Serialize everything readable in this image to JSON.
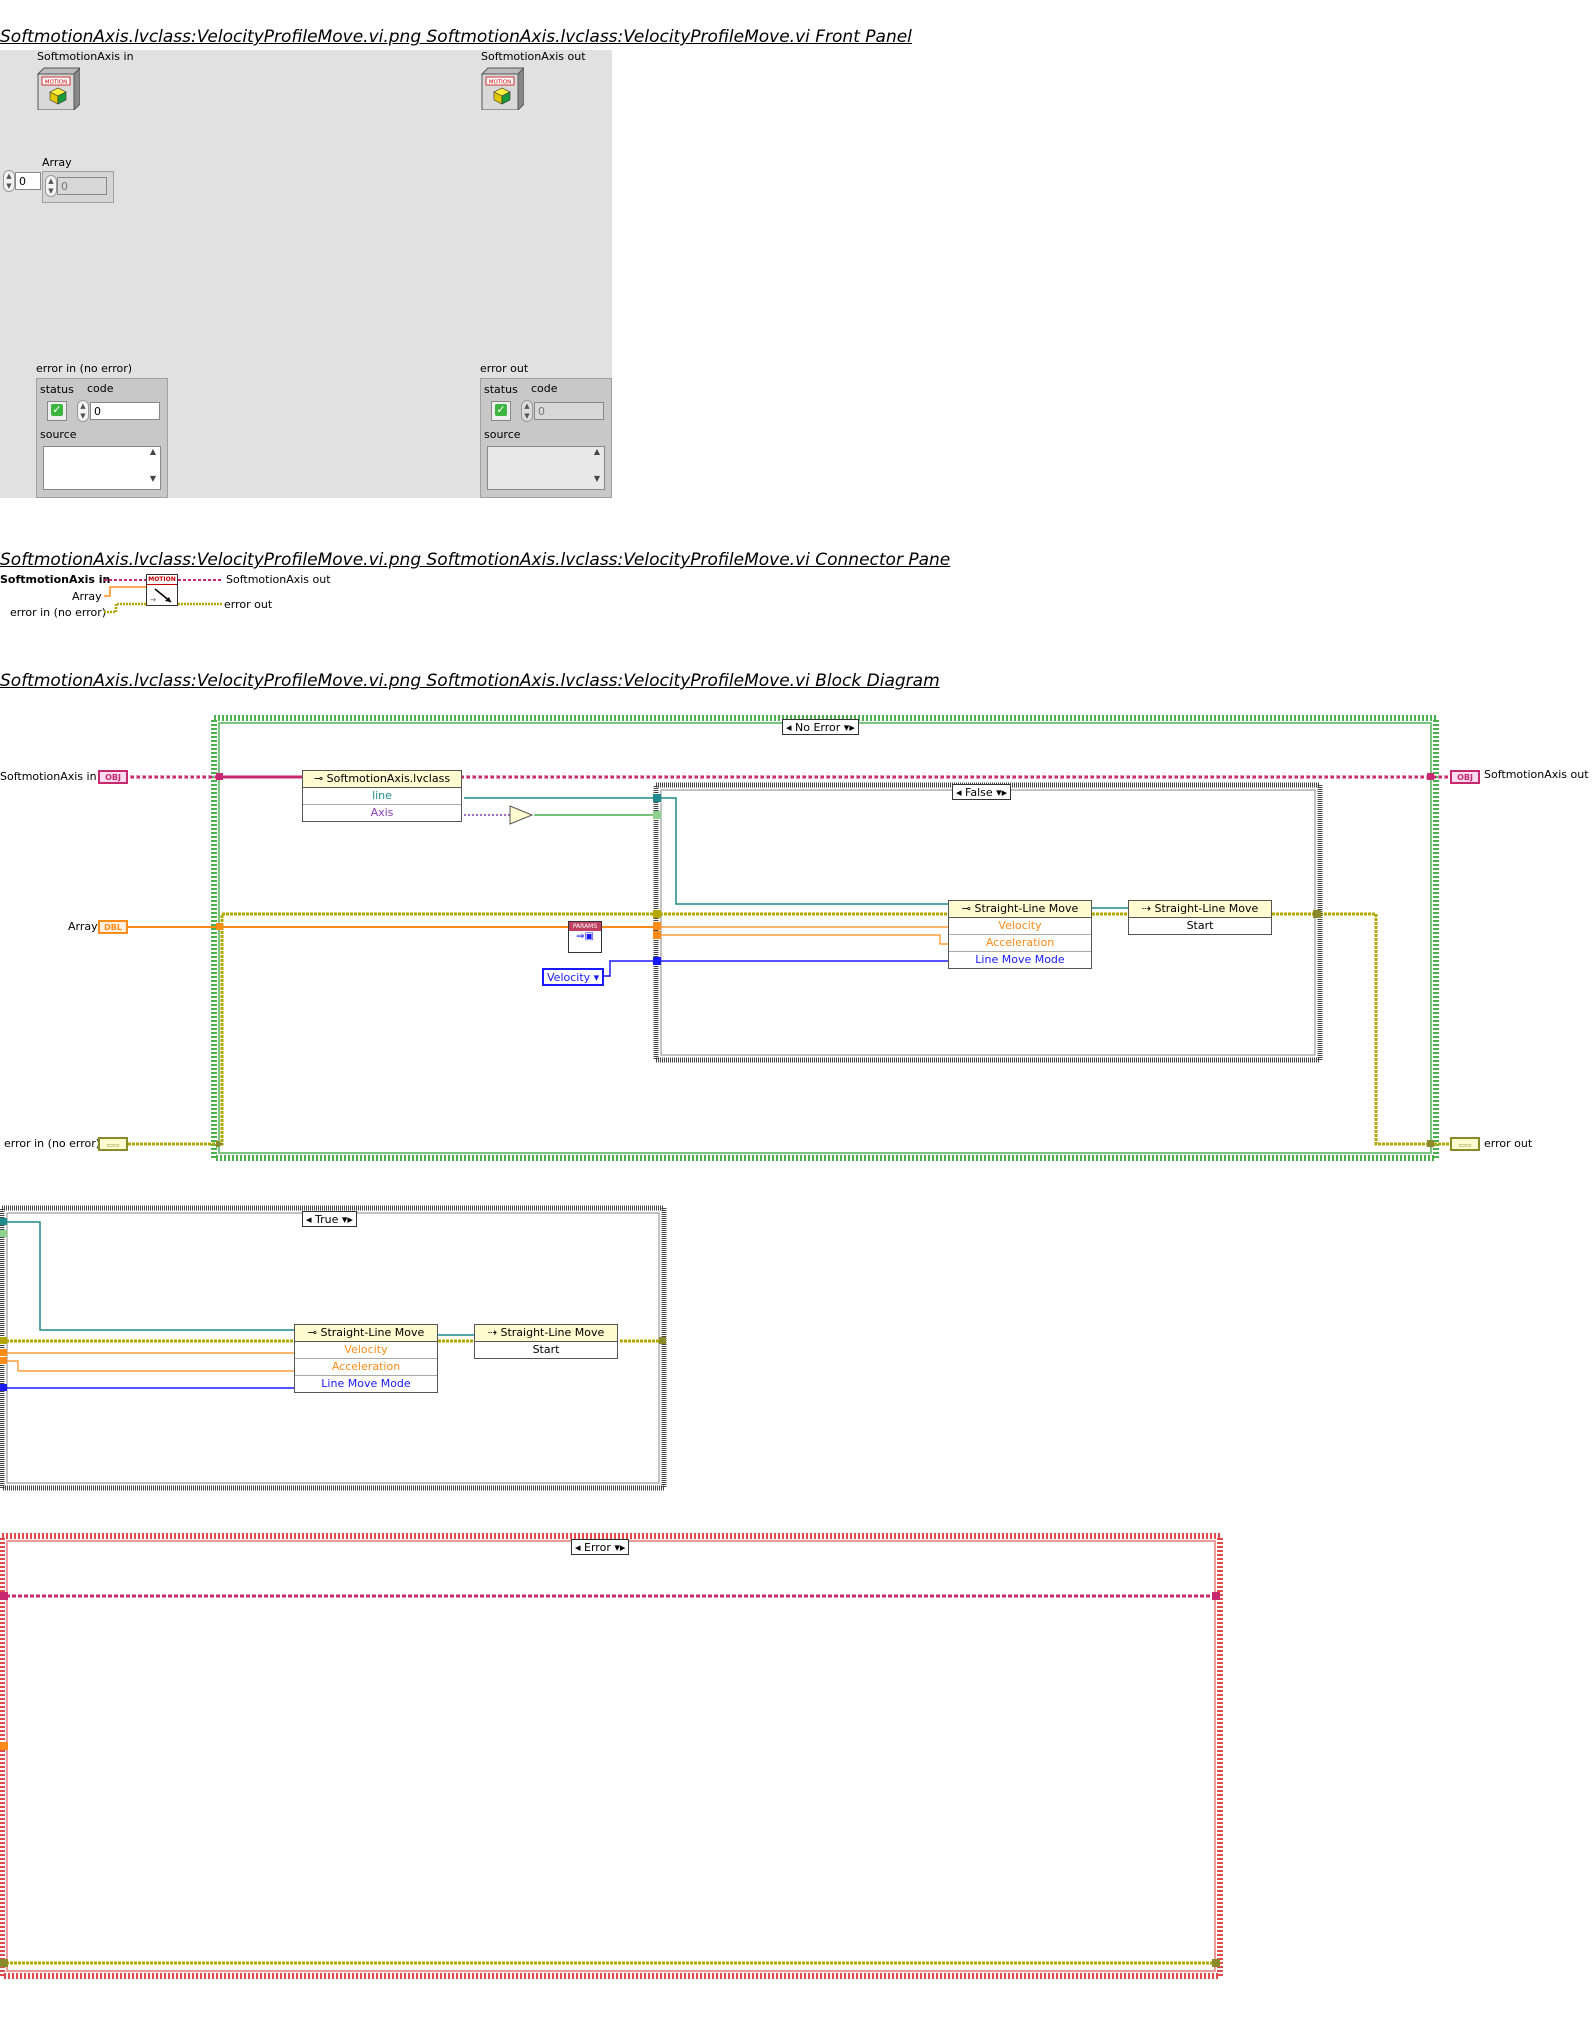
{
  "headers": {
    "front_panel": "SoftmotionAxis.lvclass:VelocityProfileMove.vi.png  SoftmotionAxis.lvclass:VelocityProfileMove.vi Front Panel",
    "connector_pane": "SoftmotionAxis.lvclass:VelocityProfileMove.vi.png  SoftmotionAxis.lvclass:VelocityProfileMove.vi Connector Pane",
    "block_diagram": "SoftmotionAxis.lvclass:VelocityProfileMove.vi.png  SoftmotionAxis.lvclass:VelocityProfileMove.vi Block Diagram"
  },
  "front_panel": {
    "axis_in_label": "SoftmotionAxis in",
    "axis_out_label": "SoftmotionAxis out",
    "class_icon_text": "MOTION",
    "array_label": "Array",
    "array_index": "0",
    "array_value": "0",
    "error_in": {
      "label": "error in (no error)",
      "status_label": "status",
      "code_label": "code",
      "code_value": "0",
      "source_label": "source"
    },
    "error_out": {
      "label": "error out",
      "status_label": "status",
      "code_label": "code",
      "code_value": "0",
      "source_label": "source"
    }
  },
  "connector": {
    "in_axis": "SoftmotionAxis in",
    "in_array": "Array",
    "in_error": "error in (no error)",
    "out_axis": "SoftmotionAxis out",
    "out_error": "error out",
    "icon_text": "MOTION"
  },
  "diagram": {
    "outer_case": "No Error",
    "inner_false_case": "False",
    "true_case": "True",
    "error_case": "Error",
    "term_axis_in": "SoftmotionAxis in",
    "term_array": "Array",
    "term_error_in": "error in (no error)",
    "term_axis_out": "SoftmotionAxis out",
    "term_error_out": "error out",
    "obj_tag": "OBJ",
    "dbl_tag": "DBL",
    "params_tag": "PARAMS",
    "unbundle": {
      "title": "SoftmotionAxis.lvclass",
      "row1": "line",
      "row2": "Axis"
    },
    "prop_node": {
      "title": "Straight-Line Move",
      "row1": "Velocity",
      "row2": "Acceleration",
      "row3": "Line Move Mode"
    },
    "invoke_node": {
      "title": "Straight-Line Move",
      "row1": "Start"
    },
    "velocity_const": "Velocity"
  },
  "colors": {
    "class_wire": "#c8286e",
    "orange_wire": "#ff8c1a",
    "error_wire": "#b4a800",
    "teal_wire": "#1e8c8c",
    "blue_wire": "#1a1aff",
    "purple_wire": "#8c3cb4",
    "no_error_frame": "#4caf50",
    "error_frame": "#e04a4a"
  }
}
